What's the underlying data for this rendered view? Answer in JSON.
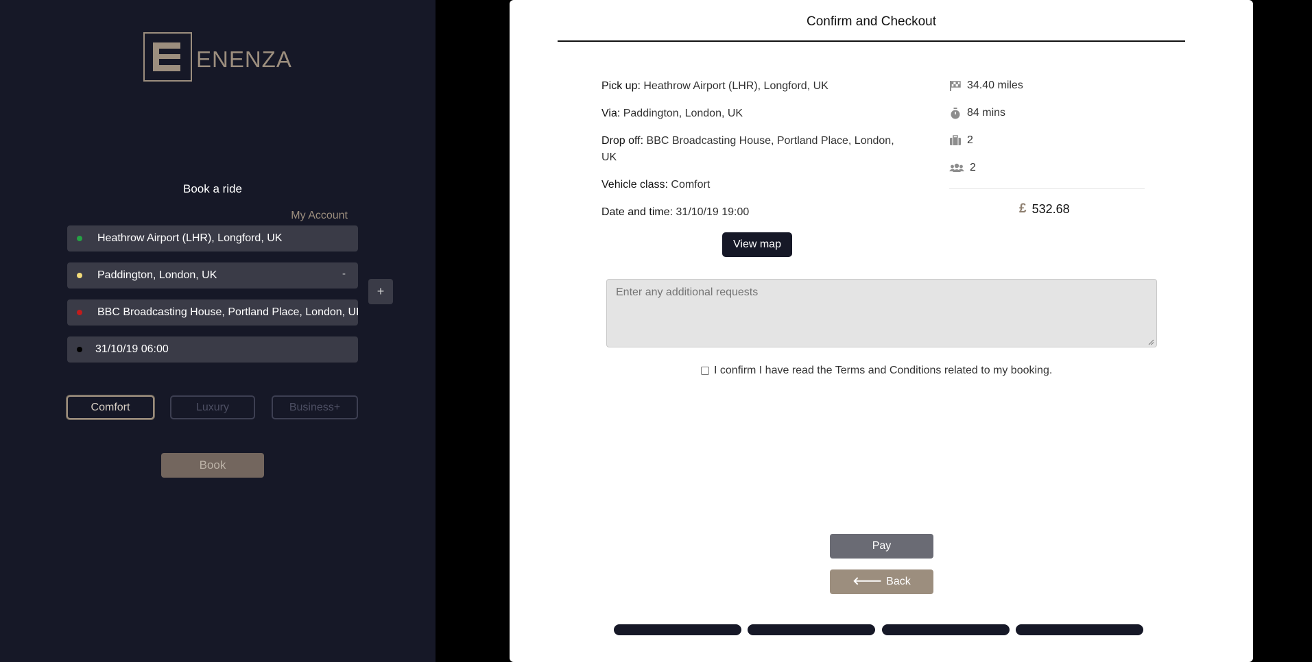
{
  "brand": {
    "name": "ENENZA"
  },
  "sidebar": {
    "title": "Book a ride",
    "my_account": "My Account",
    "pickup": "Heathrow Airport (LHR), Longford, UK",
    "via": "Paddington, London, UK",
    "via_remove": "-",
    "dropoff": "BBC Broadcasting House, Portland Place, London, UK",
    "datetime": "31/10/19 06:00",
    "add_stop": "+",
    "classes": [
      "Comfort",
      "Luxury",
      "Business+"
    ],
    "selected_class": "Comfort",
    "book_label": "Book",
    "colors": {
      "pickup": "#25a244",
      "via": "#f3dc7a",
      "dropoff": "#c21c1c",
      "datetime": "#000000"
    }
  },
  "checkout": {
    "title": "Confirm and Checkout",
    "pickup_label": "Pick up:",
    "pickup_value": "Heathrow Airport (LHR), Longford, UK",
    "via_label": "Via:",
    "via_value": "Paddington, London, UK",
    "dropoff_label": "Drop off:",
    "dropoff_value": "BBC Broadcasting House, Portland Place, London, UK",
    "vehicle_label": "Vehicle class:",
    "vehicle_value": "Comfort",
    "datetime_label": "Date and time:",
    "datetime_value": "31/10/19 19:00",
    "distance": "34.40 miles",
    "duration": "84 mins",
    "luggage": "2",
    "passengers": "2",
    "currency": "£",
    "price": "532.68",
    "view_map_label": "View map",
    "requests_placeholder": "Enter any additional requests",
    "confirm_text": "I confirm I have read the Terms and Conditions related to my booking.",
    "pay_label": "Pay",
    "back_label": "Back",
    "progress_steps": 4
  }
}
